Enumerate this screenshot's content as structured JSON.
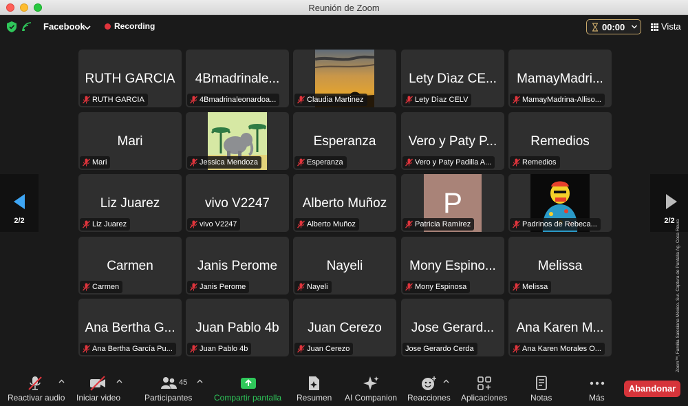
{
  "window": {
    "title": "Reunión de Zoom"
  },
  "topbar": {
    "account": "Facebook",
    "recording": "Recording",
    "timer": "00:00",
    "view": "Vista"
  },
  "nav": {
    "page": "2/2"
  },
  "tiles": [
    {
      "name": "RUTH GARCIA",
      "label": "RUTH GARCIA"
    },
    {
      "name": "4Bmadrinale...",
      "label": "4Bmadrinaleonardoa..."
    },
    {
      "name": "",
      "label": "Claudia Martinez",
      "pic": "sunset"
    },
    {
      "name": "Lety Dìaz CE...",
      "label": "Lety Dìaz CELV"
    },
    {
      "name": "MamayMadri...",
      "label": "MamayMadrina-Alliso..."
    },
    {
      "name": "Mari",
      "label": "Mari"
    },
    {
      "name": "",
      "label": "Jessica Mendoza",
      "pic": "elephant"
    },
    {
      "name": "Esperanza",
      "label": "Esperanza"
    },
    {
      "name": "Vero y Paty P...",
      "label": "Vero y Paty Padilla A..."
    },
    {
      "name": "Remedios",
      "label": "Remedios"
    },
    {
      "name": "Liz Juarez",
      "label": "Liz Juarez"
    },
    {
      "name": "vivo V2247",
      "label": "vivo V2247"
    },
    {
      "name": "Alberto Muñoz",
      "label": "Alberto Muñoz"
    },
    {
      "name": "",
      "label": "Patricia Ramírez",
      "pic": "letter",
      "letter": "P"
    },
    {
      "name": "",
      "label": "Padrinos de Rebeca...",
      "pic": "cartoon"
    },
    {
      "name": "Carmen",
      "label": "Carmen"
    },
    {
      "name": "Janis Perome",
      "label": "Janis Perome"
    },
    {
      "name": "Nayeli",
      "label": "Nayeli"
    },
    {
      "name": "Mony Espino...",
      "label": "Mony Espinosa"
    },
    {
      "name": "Melissa",
      "label": "Melissa"
    },
    {
      "name": "Ana Bertha G...",
      "label": "Ana Bertha García Pu..."
    },
    {
      "name": "Juan Pablo 4b",
      "label": "Juan Pablo 4b"
    },
    {
      "name": "Juan Cerezo",
      "label": "Juan Cerezo"
    },
    {
      "name": "Jose Gerard...",
      "label": "Jose Gerardo Cerda",
      "unmuted": true
    },
    {
      "name": "Ana Karen M...",
      "label": "Ana Karen Morales O..."
    }
  ],
  "toolbar": {
    "audio": "Reactivar audio",
    "video": "Iniciar video",
    "participants": "Participantes",
    "participants_count": "45",
    "share": "Compartir pantalla",
    "summary": "Resumen",
    "companion": "AI Companion",
    "reactions": "Reacciones",
    "apps": "Aplicaciones",
    "notes": "Notas",
    "more": "Más",
    "leave": "Abandonar"
  },
  "credit": "Cortesía © Zoom™, Familia Salesiana México. Sur. Captura de Pantalla Ag. Coca Roura",
  "colors": {
    "accent_green": "#2fc75a",
    "leave_red": "#d6343a",
    "mute_red": "#e0343c"
  }
}
